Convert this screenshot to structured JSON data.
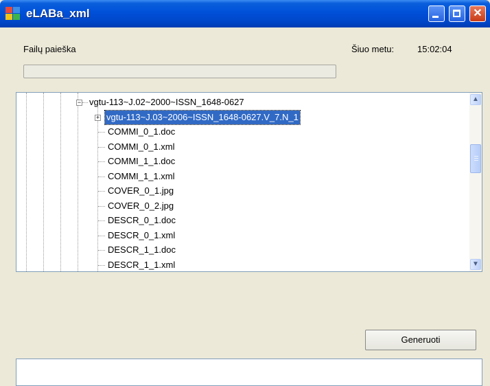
{
  "window": {
    "title": "eLABa_xml",
    "controls": {
      "minimize_icon": "minimize-icon",
      "maximize_icon": "maximize-icon",
      "close_icon": "close-icon"
    }
  },
  "form": {
    "search_label": "Failų paieška",
    "time_label": "Šiuo metu:",
    "time_value": "15:02:04",
    "progress_fraction": 0.0
  },
  "tree": {
    "nodes": [
      {
        "label": "vgtu-113~J.02~2000~ISSN_1648-0627",
        "expander": "⊟",
        "selected": false
      },
      {
        "label": "vgtu-113~J.03~2006~ISSN_1648-0627.V_7.N_1",
        "expander": "+",
        "selected": true
      },
      {
        "label": "COMMI_0_1.doc"
      },
      {
        "label": "COMMI_0_1.xml"
      },
      {
        "label": "COMMI_1_1.doc"
      },
      {
        "label": "COMMI_1_1.xml"
      },
      {
        "label": "COVER_0_1.jpg"
      },
      {
        "label": "COVER_0_2.jpg"
      },
      {
        "label": "DESCR_0_1.doc"
      },
      {
        "label": "DESCR_0_1.xml"
      },
      {
        "label": "DESCR_1_1.doc"
      },
      {
        "label": "DESCR_1_1.xml"
      }
    ],
    "scrollbar": {
      "up_icon": "scroll-up-icon",
      "down_icon": "scroll-down-icon"
    }
  },
  "actions": {
    "generate_label": "Generuoti"
  },
  "colors": {
    "titlebar": "#0050d8",
    "selection": "#316ac5",
    "window_bg": "#ece9d8"
  }
}
